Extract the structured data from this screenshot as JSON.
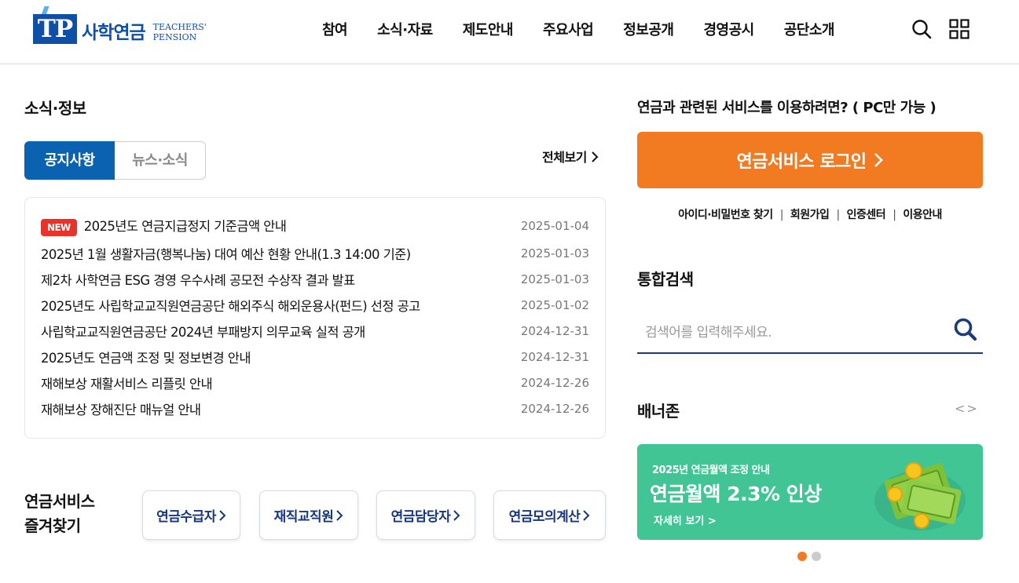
{
  "header": {
    "logo_mark": "TP",
    "logo_ko": "사학연금",
    "logo_en_1": "TEACHERS'",
    "logo_en_2": "PENSION",
    "nav": [
      "참여",
      "소식·자료",
      "제도안내",
      "주요사업",
      "정보공개",
      "경영공시",
      "공단소개"
    ]
  },
  "news": {
    "title": "소식·정보",
    "tabs": [
      {
        "label": "공지사항",
        "active": true
      },
      {
        "label": "뉴스·소식",
        "active": false
      }
    ],
    "view_all": "전체보기",
    "new_badge": "NEW",
    "items": [
      {
        "title": "2025년도 연금지급정지 기준금액 안내",
        "date": "2025-01-04",
        "is_new": true
      },
      {
        "title": "2025년 1월 생활자금(행복나눔) 대여 예산 현황 안내(1.3 14:00 기준)",
        "date": "2025-01-03"
      },
      {
        "title": "제2차 사학연금 ESG 경영 우수사례 공모전 수상작 결과 발표",
        "date": "2025-01-03"
      },
      {
        "title": "2025년도 사립학교교직원연금공단 해외주식 해외운용사(펀드) 선정 공고",
        "date": "2025-01-02"
      },
      {
        "title": "사립학교교직원연금공단 2024년 부패방지 의무교육 실적 공개",
        "date": "2024-12-31"
      },
      {
        "title": "2025년도 연금액 조정 및 정보변경 안내",
        "date": "2024-12-31"
      },
      {
        "title": "재해보상 재활서비스 리플릿 안내",
        "date": "2024-12-26"
      },
      {
        "title": "재해보상 장해진단 매뉴얼 안내",
        "date": "2024-12-26"
      }
    ]
  },
  "favorites": {
    "title_1": "연금서비스",
    "title_2": "즐겨찾기",
    "buttons": [
      "연금수급자",
      "재직교직원",
      "연금담당자",
      "연금모의계산"
    ]
  },
  "service": {
    "text": "연금과 관련된 서비스를 이용하려면? ( PC만 가능 )",
    "login_label": "연금서비스 로그인",
    "links": [
      "아이디·비밀번호 찾기",
      "회원가입",
      "인증센터",
      "이용안내"
    ]
  },
  "search": {
    "title": "통합검색",
    "placeholder": "검색어를 입력해주세요."
  },
  "banner": {
    "title": "배너존",
    "subtitle": "2025년 연금월액 조정 안내",
    "headline": "연금월액 2.3% 인상",
    "more": "자세히 보기 >",
    "prev": "<",
    "next": ">",
    "active_index": 0,
    "count": 2
  },
  "colors": {
    "brand_blue": "#0f4fa8",
    "tab_blue": "#0a62b0",
    "login_orange": "#f27b22",
    "banner_green": "#41c595",
    "new_red": "#e8322a",
    "dot_active": "#f27b22",
    "dot_inactive": "#cccccc"
  }
}
